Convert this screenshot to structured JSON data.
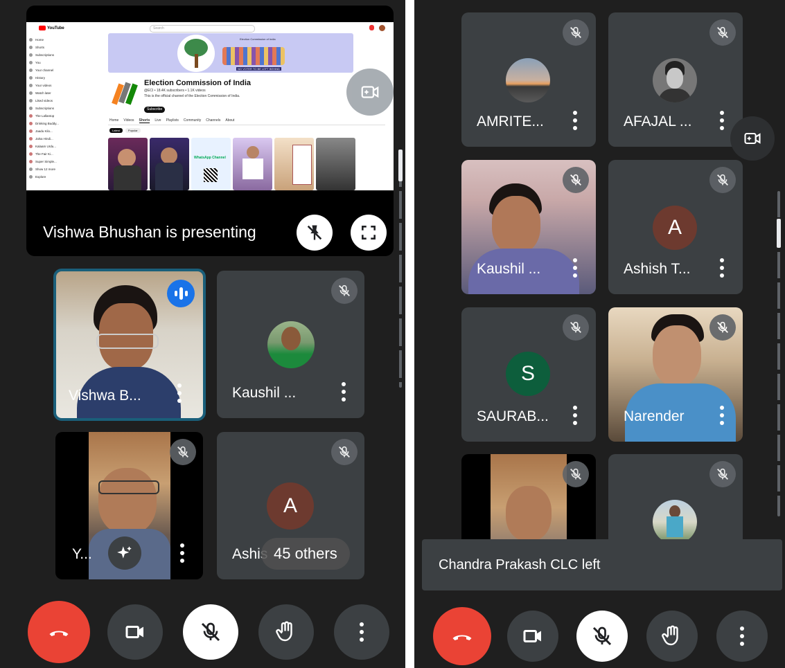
{
  "left_panel": {
    "presentation": {
      "presenter_text": "Vishwa Bhushan is presenting",
      "youtube": {
        "logo_text": "YouTube",
        "search_placeholder": "Search",
        "sidebar_items": [
          "Home",
          "Shorts",
          "Subscriptions",
          "You",
          "Your channel",
          "History",
          "Your videos",
          "Watch later",
          "Liked videos",
          "Subscriptions",
          "The Lallantop",
          "Drinking Buddy...",
          "Jaadu Kilo...",
          "Jalsa Hindi...",
          "Kalaam Urdu...",
          "The Fair Ki...",
          "Super Simple...",
          "Show 12 more",
          "Explore"
        ],
        "channel_name": "Election Commission of India",
        "channel_handle": "@ECI • 18.4K subscribers • 1.1K videos",
        "channel_desc": "This is the official channel of the Election Commission of India.",
        "subscribe_label": "Subscribe",
        "tabs": [
          "Home",
          "Videos",
          "Shorts",
          "Live",
          "Playlists",
          "Community",
          "Channels",
          "About"
        ],
        "filters": [
          "Latest",
          "Popular"
        ],
        "banner_text": "NO VOTER TO BE LEFT BEHIND",
        "banner_org": "Election Commission of India",
        "whatsapp_text": "WhatsApp Channel"
      }
    },
    "tiles": [
      {
        "name": "Vishwa B...",
        "type": "video",
        "speaking": true
      },
      {
        "name": "Kaushil ...",
        "type": "avatar-photo",
        "muted": true
      },
      {
        "name": "Y...",
        "type": "video",
        "muted": true
      },
      {
        "name": "Ashis",
        "type": "letter",
        "letter": "A",
        "muted": true
      }
    ],
    "others_label": "45 others",
    "controls": [
      "end-call",
      "camera",
      "mic-muted",
      "raise-hand",
      "more"
    ]
  },
  "right_panel": {
    "tiles": [
      {
        "name": "AMRITE...",
        "type": "avatar-photo",
        "muted": true
      },
      {
        "name": "AFAJAL ...",
        "type": "avatar-photo",
        "muted": true
      },
      {
        "name": "Kaushil ...",
        "type": "video",
        "muted": true
      },
      {
        "name": "Ashish T...",
        "type": "letter",
        "letter": "A",
        "muted": true
      },
      {
        "name": "SAURAB...",
        "type": "letter",
        "letter": "S",
        "muted": true
      },
      {
        "name": "Narender",
        "type": "video",
        "muted": true
      },
      {
        "name": "",
        "type": "video",
        "muted": true
      },
      {
        "name": "",
        "type": "avatar-photo",
        "muted": true
      }
    ],
    "toast": "Chandra Prakash CLC left",
    "controls": [
      "end-call",
      "camera",
      "mic-muted",
      "raise-hand",
      "more"
    ]
  },
  "colors": {
    "background": "#1f1f1f",
    "tile": "#3c4043",
    "end_call": "#ea4335",
    "speaking_border": "#1a73e8",
    "avatar_brown": "#6d3a2f",
    "avatar_green": "#0d5e3c"
  }
}
